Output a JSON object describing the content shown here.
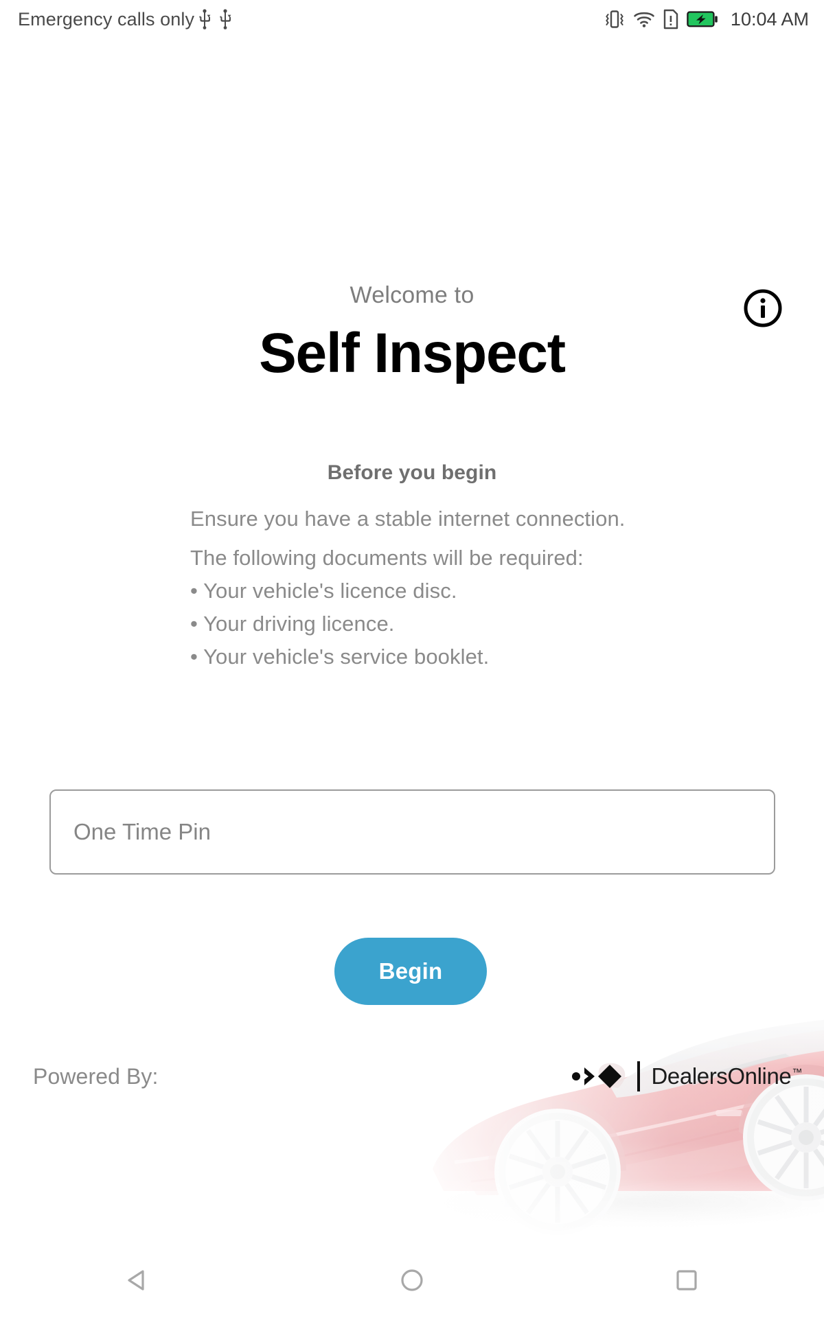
{
  "status_bar": {
    "carrier": "Emergency calls only",
    "clock": "10:04 AM",
    "icons": [
      "usb-icon",
      "usb-icon",
      "vibrate-icon",
      "wifi-icon",
      "sim-alert-icon",
      "battery-charging-icon"
    ],
    "battery_color": "#22c55e",
    "text_color": "#4a4a4a"
  },
  "header": {
    "welcome_label": "Welcome to",
    "app_title": "Self Inspect",
    "info_icon": "info-circle-icon"
  },
  "instructions": {
    "heading": "Before you begin",
    "lines": [
      "Ensure you have a stable internet connection.",
      "The following documents will be required:"
    ],
    "bullets": [
      "• Your vehicle's licence disc.",
      "• Your driving licence.",
      "• Your vehicle's service booklet."
    ]
  },
  "form": {
    "otp_placeholder": "One Time Pin",
    "otp_value": "",
    "begin_label": "Begin",
    "begin_color": "#3ba3ce"
  },
  "footer": {
    "powered_by_label": "Powered By:",
    "brand_name": "DealersOnline",
    "brand_tm": "™",
    "brand_logo_icon": "dealersonline-logo-icon",
    "background_image": "red-sports-car-image"
  },
  "nav_bar": {
    "back_icon": "back-triangle-icon",
    "home_icon": "home-circle-icon",
    "recents_icon": "recents-square-icon",
    "icon_color": "#a8a8a8"
  }
}
